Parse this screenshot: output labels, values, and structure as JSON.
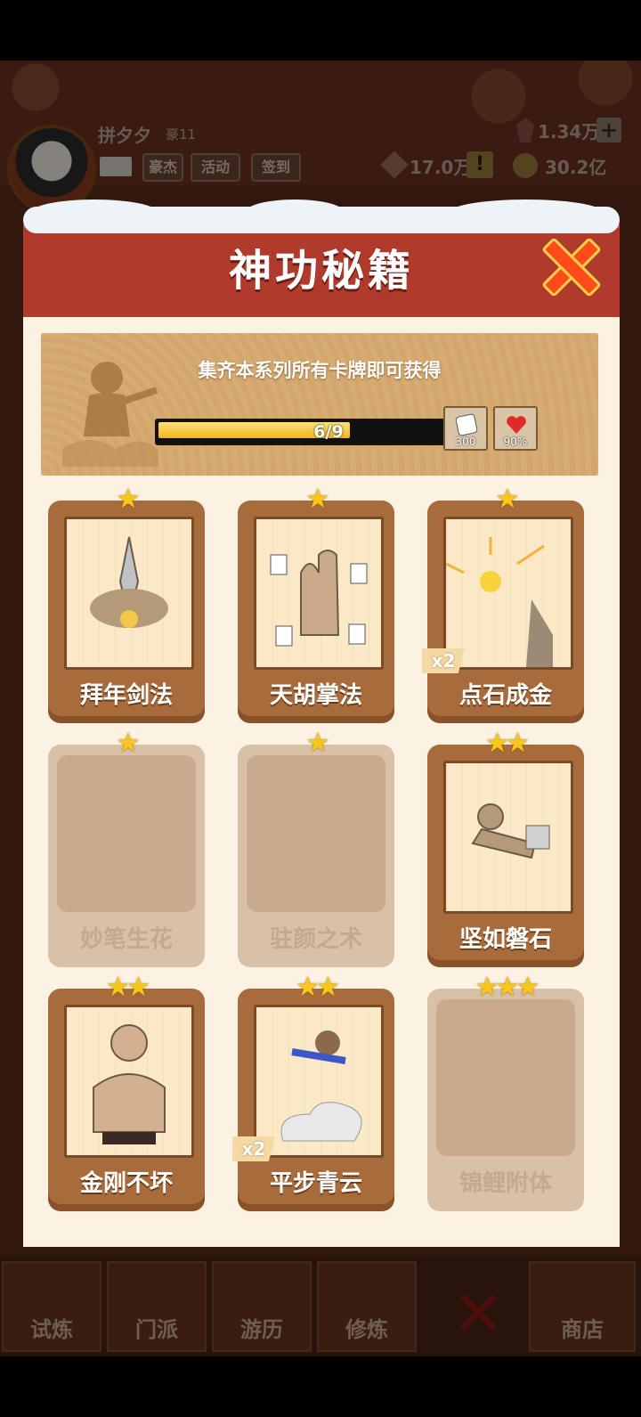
{
  "hud": {
    "player_name": "拼夕夕",
    "rank": "豪11",
    "chips": [
      "豪杰",
      "活动",
      "签到"
    ],
    "gems": "1.34万",
    "diamonds": "17.0万",
    "coins": "30.2亿",
    "plus": "+",
    "warn": "!"
  },
  "dialog": {
    "title": "神功秘籍",
    "banner_text": "集齐本系列所有卡牌即可获得",
    "progress_text": "6/9",
    "progress_value": 0.667,
    "rewards": [
      {
        "icon": "dice-icon",
        "value": "300"
      },
      {
        "icon": "heart-icon",
        "value": "90%"
      }
    ]
  },
  "cards": [
    {
      "name": "拜年剑法",
      "stars": "★",
      "locked": false,
      "badge": ""
    },
    {
      "name": "天胡掌法",
      "stars": "★",
      "locked": false,
      "badge": ""
    },
    {
      "name": "点石成金",
      "stars": "★",
      "locked": false,
      "badge": "x2"
    },
    {
      "name": "妙笔生花",
      "stars": "★",
      "locked": true,
      "badge": ""
    },
    {
      "name": "驻颜之术",
      "stars": "★",
      "locked": true,
      "badge": ""
    },
    {
      "name": "坚如磐石",
      "stars": "★★",
      "locked": false,
      "badge": ""
    },
    {
      "name": "金刚不坏",
      "stars": "★★",
      "locked": false,
      "badge": ""
    },
    {
      "name": "平步青云",
      "stars": "★★",
      "locked": false,
      "badge": "x2"
    },
    {
      "name": "锦鲤附体",
      "stars": "★★★",
      "locked": true,
      "badge": ""
    }
  ],
  "nav": {
    "tabs": [
      "试炼",
      "门派",
      "游历",
      "修炼",
      "商店"
    ],
    "close": "✕"
  },
  "colors": {
    "header_red": "#b03a2b",
    "card_brown": "#a86b3c",
    "star_gold": "#f7c81a",
    "progress_gold": "#f1b31c"
  }
}
